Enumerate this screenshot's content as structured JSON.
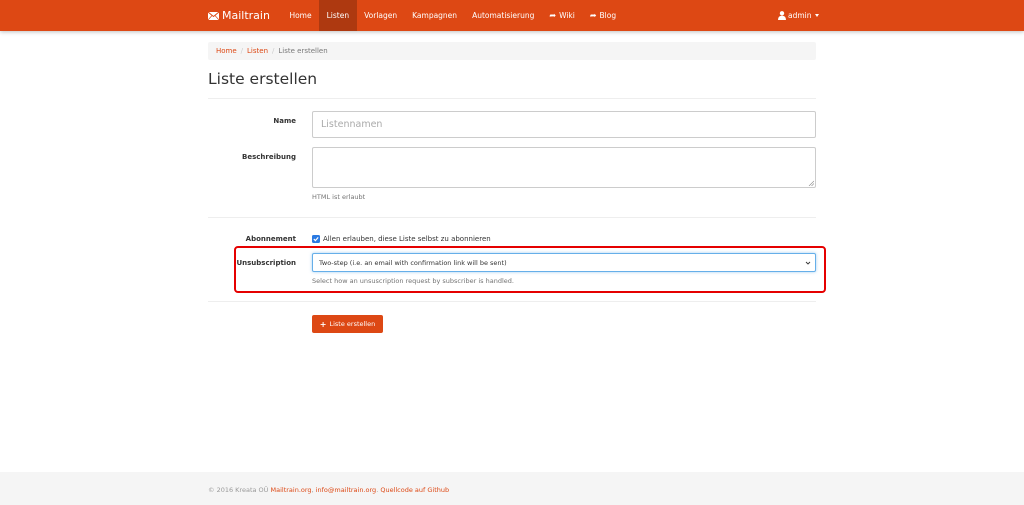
{
  "navbar": {
    "brand": "Mailtrain",
    "items": [
      {
        "label": "Home"
      },
      {
        "label": "Listen",
        "active": true
      },
      {
        "label": "Vorlagen"
      },
      {
        "label": "Kampagnen"
      },
      {
        "label": "Automatisierung"
      },
      {
        "label": "Wiki",
        "icon": "share-arrow-icon"
      },
      {
        "label": "Blog",
        "icon": "share-arrow-icon"
      }
    ],
    "user": "admin"
  },
  "breadcrumb": {
    "home": "Home",
    "sep": "/",
    "lists": "Listen",
    "current": "Liste erstellen"
  },
  "page": {
    "title": "Liste erstellen"
  },
  "form": {
    "name_label": "Name",
    "name_placeholder": "Listennamen",
    "description_label": "Beschreibung",
    "description_help": "HTML ist erlaubt",
    "subscription_label": "Abonnement",
    "subscription_checkbox_label": "Allen erlauben, diese Liste selbst zu abonnieren",
    "subscription_checked": true,
    "unsubscription_label": "Unsubscription",
    "unsubscription_selected": "Two-step (i.e. an email with confirmation link will be sent)",
    "unsubscription_help": "Select how an unsuscription request by subscriber is handled.",
    "submit_label": "Liste erstellen"
  },
  "footer": {
    "copyright": "© 2016 Kreata OÜ ",
    "link_site": "Mailtrain.org",
    "link_email": "info@mailtrain.org",
    "link_source": "Quellcode auf Github",
    "sep": ", ",
    "end": ". "
  },
  "colors": {
    "brand": "#dd4814",
    "brand_active": "#ae3910",
    "highlight": "#e50000",
    "checkbox": "#2a7ae2"
  }
}
